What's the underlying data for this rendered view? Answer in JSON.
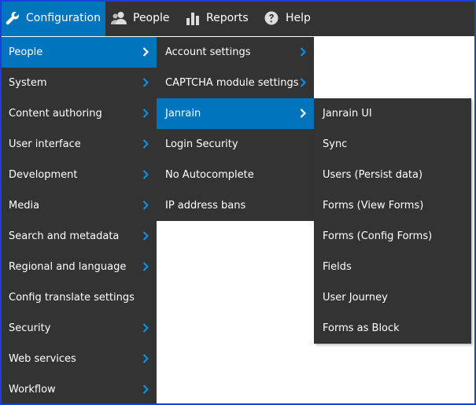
{
  "toolbar": {
    "items": [
      {
        "label": "Configuration",
        "icon": "wrench-icon"
      },
      {
        "label": "People",
        "icon": "people-icon"
      },
      {
        "label": "Reports",
        "icon": "bar-chart-icon"
      },
      {
        "label": "Help",
        "icon": "question-circle-icon"
      }
    ]
  },
  "menus": {
    "level1": [
      {
        "label": "People",
        "has_submenu": true,
        "active": true
      },
      {
        "label": "System",
        "has_submenu": true
      },
      {
        "label": "Content authoring",
        "has_submenu": true
      },
      {
        "label": "User interface",
        "has_submenu": true
      },
      {
        "label": "Development",
        "has_submenu": true
      },
      {
        "label": "Media",
        "has_submenu": true
      },
      {
        "label": "Search and metadata",
        "has_submenu": true
      },
      {
        "label": "Regional and language",
        "has_submenu": true
      },
      {
        "label": "Config translate settings",
        "has_submenu": false
      },
      {
        "label": "Security",
        "has_submenu": true
      },
      {
        "label": "Web services",
        "has_submenu": true
      },
      {
        "label": "Workflow",
        "has_submenu": true
      }
    ],
    "level2": [
      {
        "label": "Account settings",
        "has_submenu": true
      },
      {
        "label": "CAPTCHA module settings",
        "has_submenu": true
      },
      {
        "label": "Janrain",
        "has_submenu": true,
        "active": true
      },
      {
        "label": "Login Security",
        "has_submenu": false
      },
      {
        "label": "No Autocomplete",
        "has_submenu": false
      },
      {
        "label": "IP address bans",
        "has_submenu": false
      }
    ],
    "level3": [
      {
        "label": "Janrain UI"
      },
      {
        "label": "Sync"
      },
      {
        "label": "Users (Persist data)"
      },
      {
        "label": "Forms (View Forms)"
      },
      {
        "label": "Forms (Config Forms)"
      },
      {
        "label": "Fields"
      },
      {
        "label": "User Journey"
      },
      {
        "label": "Forms as Block"
      }
    ]
  },
  "colors": {
    "toolbar_bg": "#333333",
    "active_bg": "#0074bd",
    "chevron_on_dark": "#0a8fe6",
    "text": "#ffffff"
  }
}
